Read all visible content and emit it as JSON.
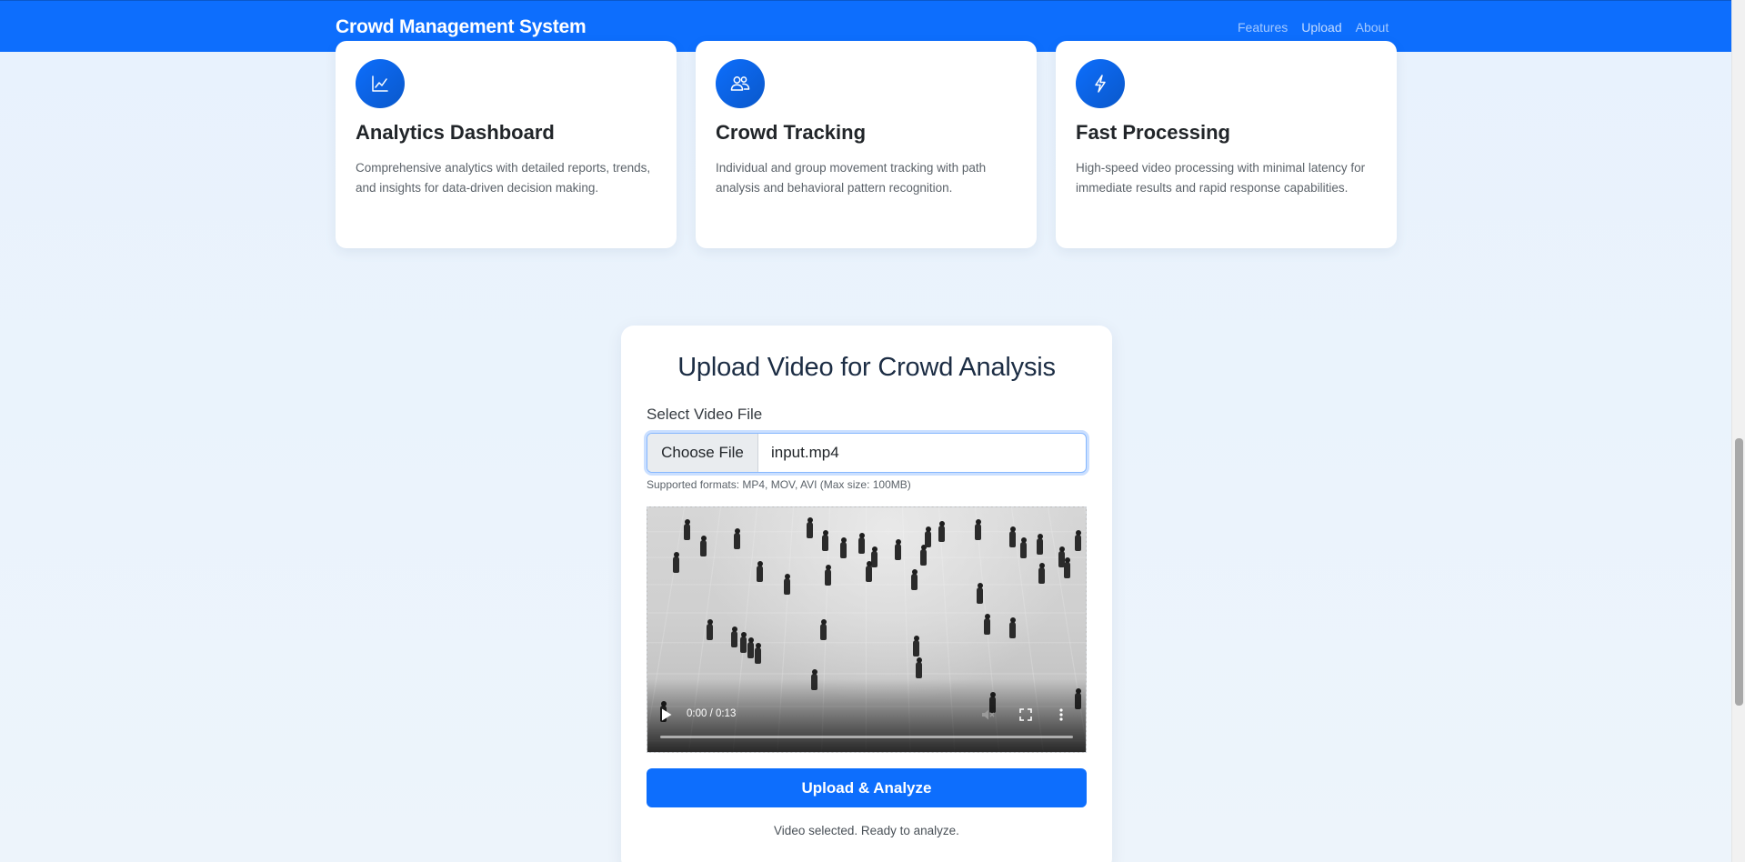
{
  "navbar": {
    "brand": "Crowd Management System",
    "links": [
      "Features",
      "Upload",
      "About"
    ]
  },
  "features": [
    {
      "icon": "chart-line-icon",
      "title": "Analytics Dashboard",
      "description": "Comprehensive analytics with detailed reports, trends, and insights for data-driven decision making."
    },
    {
      "icon": "people-icon",
      "title": "Crowd Tracking",
      "description": "Individual and group movement tracking with path analysis and behavioral pattern recognition."
    },
    {
      "icon": "lightning-icon",
      "title": "Fast Processing",
      "description": "High-speed video processing with minimal latency for immediate results and rapid response capabilities."
    }
  ],
  "upload": {
    "title": "Upload Video for Crowd Analysis",
    "field_label": "Select Video File",
    "choose_label": "Choose File",
    "file_name": "input.mp4",
    "help_text": "Supported formats: MP4, MOV, AVI (Max size: 100MB)",
    "video": {
      "time": "0:00 / 0:13",
      "progress": 0
    },
    "submit_label": "Upload & Analyze",
    "status": "Video selected. Ready to analyze."
  },
  "colors": {
    "primary": "#0d6efd",
    "background": "#eaf3fd"
  }
}
